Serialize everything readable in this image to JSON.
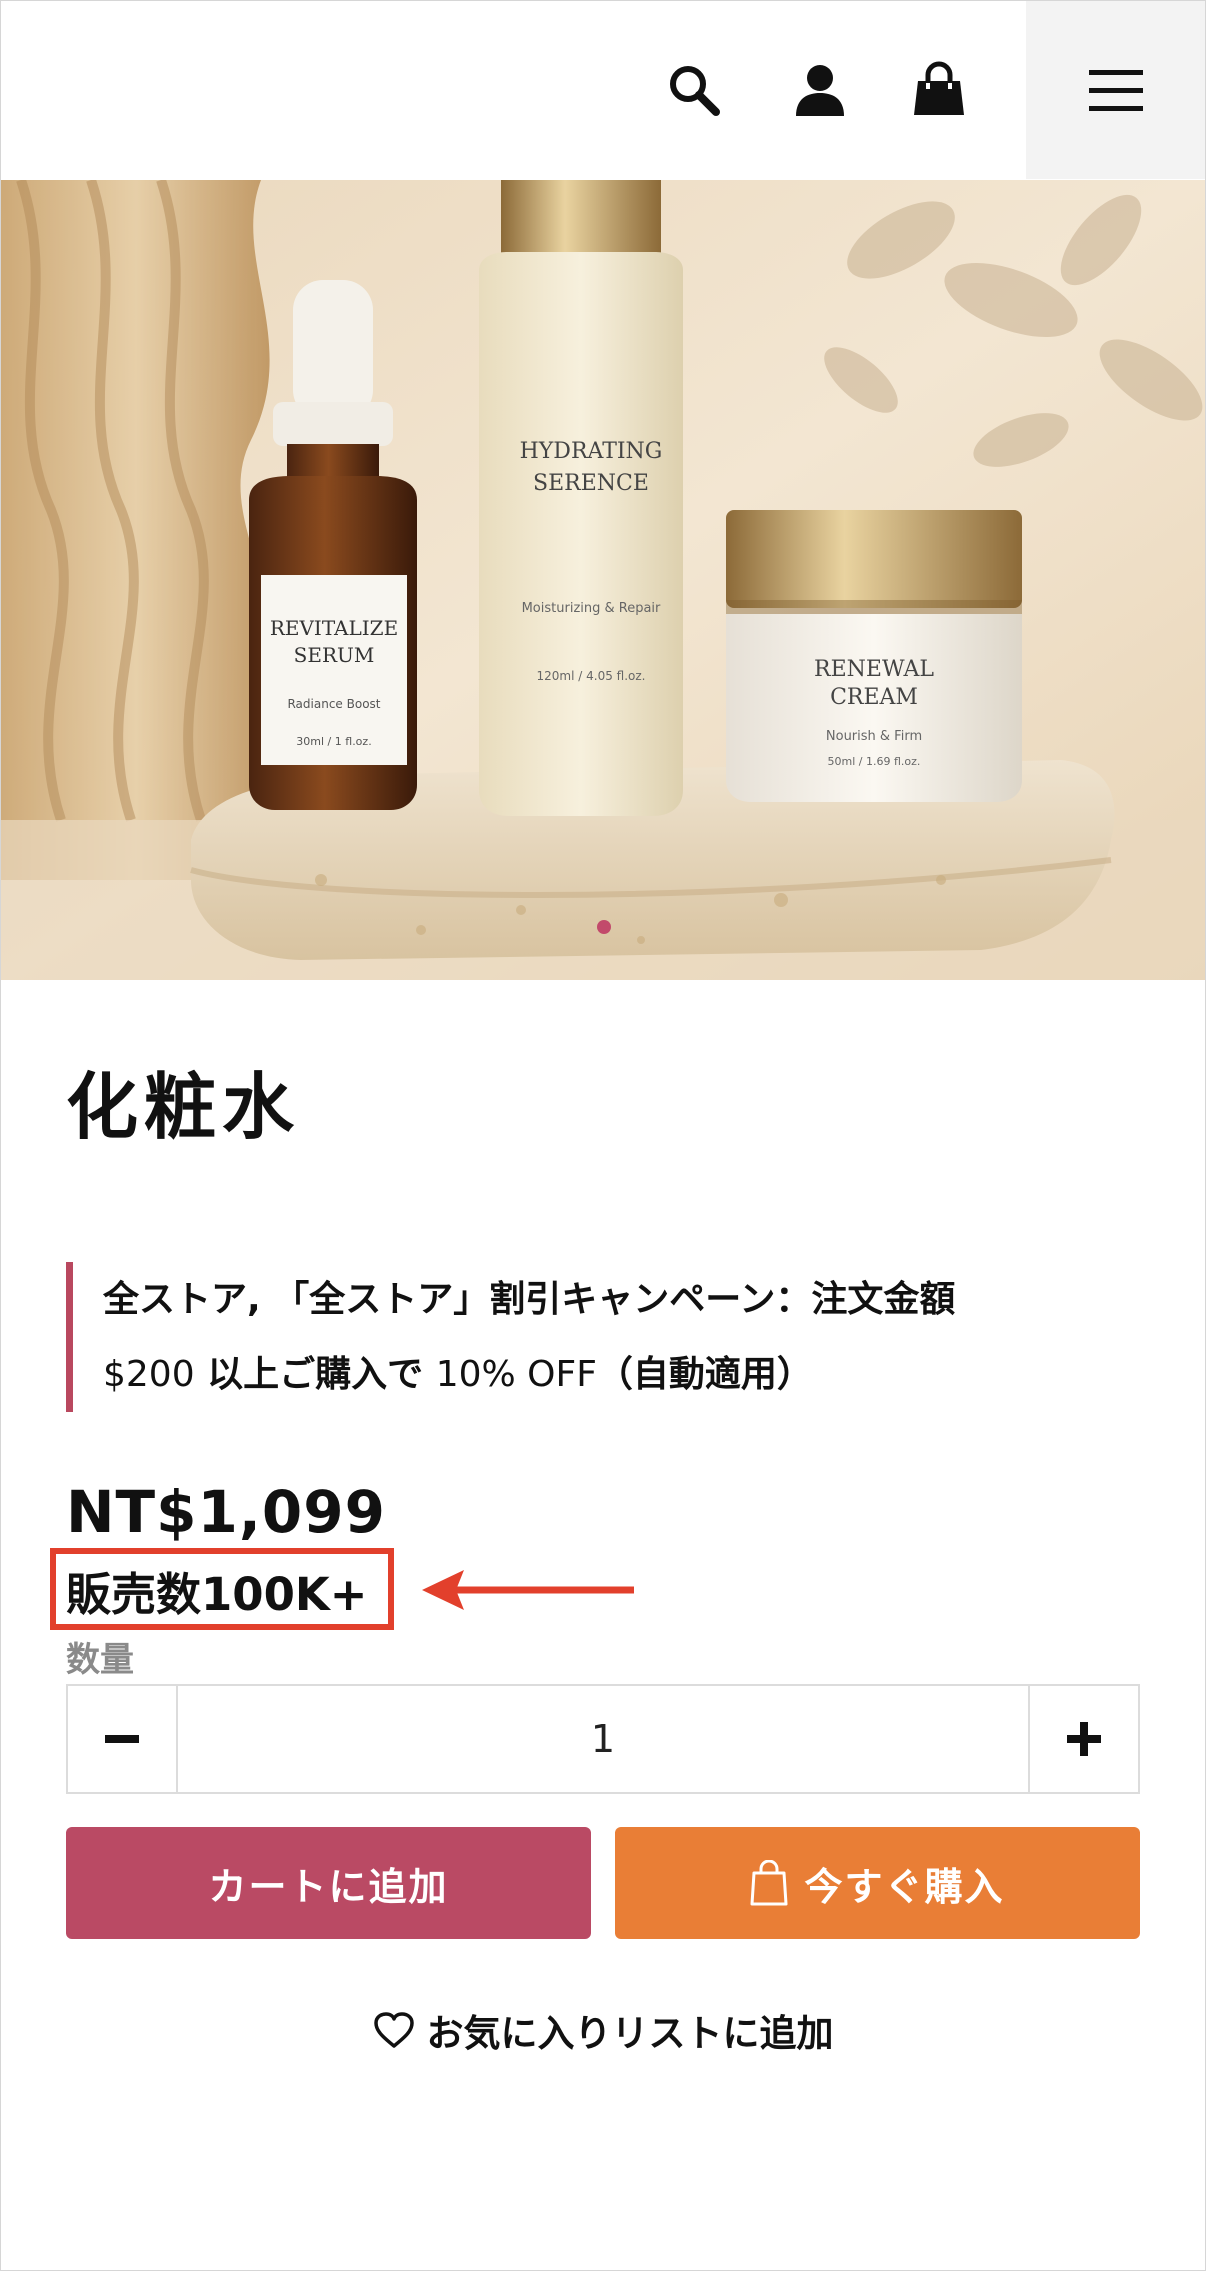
{
  "header": {
    "icons": [
      "search-icon",
      "account-icon",
      "cart-icon",
      "menu-icon"
    ]
  },
  "hero": {
    "products": [
      {
        "name_line1": "REVITALIZE",
        "name_line2": "SERUM",
        "sub": "Radiance Boost",
        "size": "30ml / 1 fl.oz."
      },
      {
        "name_line1": "HYDRATING",
        "name_line2": "SERENCE",
        "sub": "Moisturizing & Repair",
        "size": "120ml / 4.05 fl.oz."
      },
      {
        "name_line1": "RENEWAL",
        "name_line2": "CREAM",
        "sub": "Nourish & Firm",
        "size": "50ml / 1.69 fl.oz."
      }
    ],
    "dot_color": "#c24a6b"
  },
  "product": {
    "title": "化粧水",
    "promo": {
      "line1": "全ストア, 「全ストア」割引キャンペーン：注文金額",
      "line2_amount": "$200",
      "line2_mid": " 以上ご購入で ",
      "line2_pct": "10% OFF",
      "line2_end": "（自動適用）"
    },
    "price": "NT$1,099",
    "sold": "販売数100K+",
    "quantity_label": "数量",
    "quantity": "1",
    "minus_label": "−",
    "plus_label": "+"
  },
  "actions": {
    "add_to_cart": "カートに追加",
    "buy_now": "今すぐ購入",
    "wishlist": "お気に入りリストに追加"
  },
  "colors": {
    "cart_button": "#ba4a64",
    "buy_button": "#e97e36",
    "highlight": "#e2402c",
    "promo_bar": "#b9485f"
  }
}
